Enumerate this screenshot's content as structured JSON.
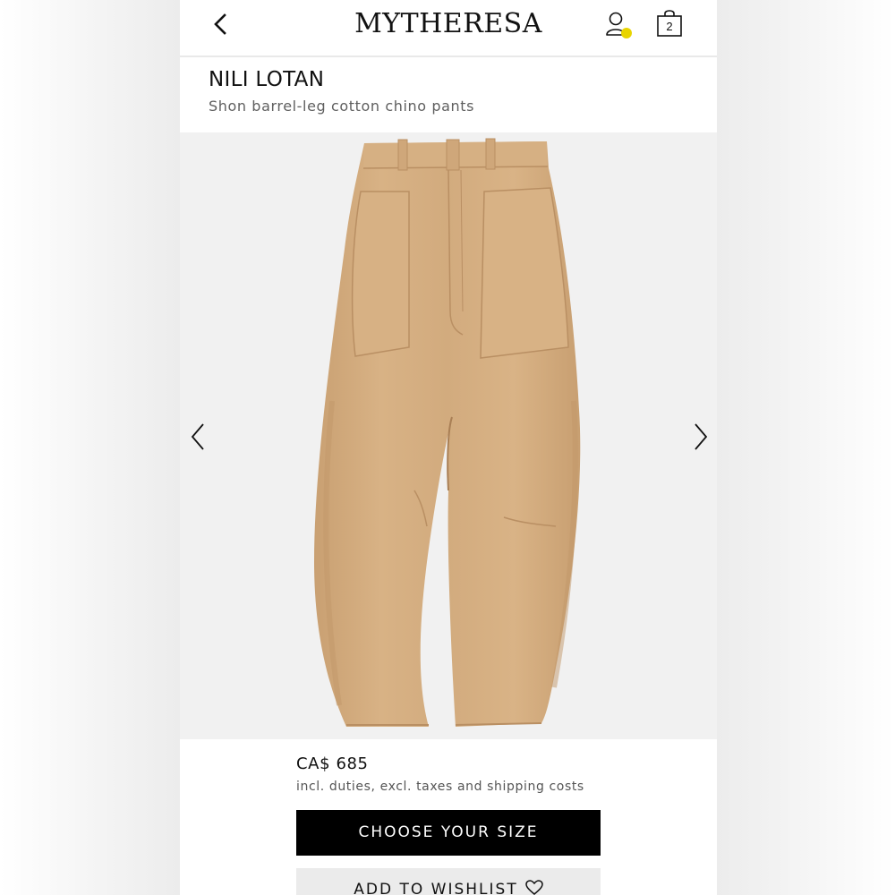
{
  "header": {
    "logo_text": "MYTHERESA",
    "cart_count": "2",
    "back_icon": "chevron-left-icon",
    "account_icon": "user-icon",
    "cart_icon": "shopping-bag-icon",
    "notification_dot_color": "#e8d400"
  },
  "product": {
    "brand": "NILI LOTAN",
    "name": "Shon barrel-leg cotton chino pants",
    "image_color": "#d4ad7f"
  },
  "gallery": {
    "prev_icon": "chevron-left-icon",
    "next_icon": "chevron-right-icon"
  },
  "purchase": {
    "price": "CA$ 685",
    "price_note": "incl. duties, excl. taxes and shipping costs",
    "choose_size_label": "CHOOSE YOUR SIZE",
    "wishlist_label": "ADD TO WISHLIST",
    "wishlist_icon": "heart-icon"
  }
}
